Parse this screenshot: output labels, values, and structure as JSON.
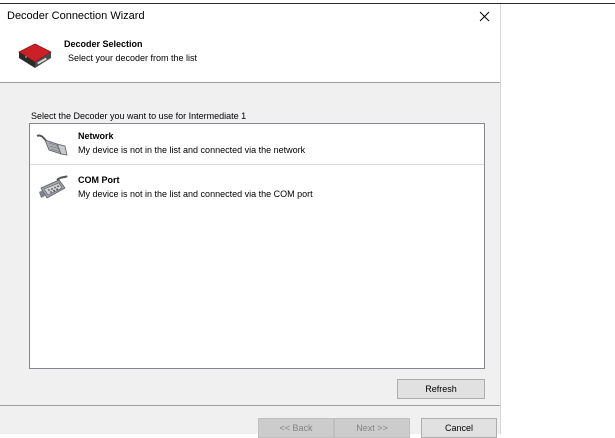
{
  "window": {
    "title": "Decoder Connection Wizard"
  },
  "header": {
    "title": "Decoder Selection",
    "subtitle": "Select your decoder from the list",
    "icon": "decoder-device-icon"
  },
  "main": {
    "prompt": "Select the Decoder you want to use for Intermediate 1",
    "items": [
      {
        "title": "Network",
        "description": "My device is not in the list and connected via the network",
        "icon": "network-cable-icon"
      },
      {
        "title": "COM Port",
        "description": "My device is not in the list and connected via the COM port",
        "icon": "serial-port-icon"
      }
    ],
    "refresh_label": "Refresh"
  },
  "footer": {
    "back_label": "<< Back",
    "next_label": "Next >>",
    "cancel_label": "Cancel"
  },
  "colors": {
    "dialog_background": "#f0f0f0",
    "accent_red": "#cc2026"
  }
}
